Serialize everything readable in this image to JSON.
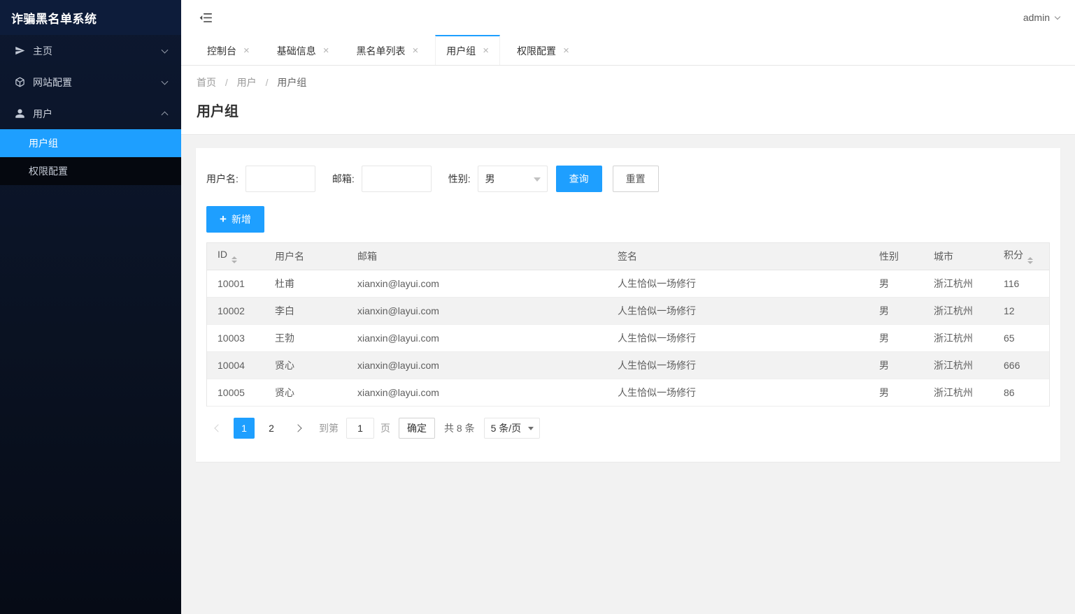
{
  "app": {
    "title": "诈骗黑名单系统"
  },
  "header": {
    "user": "admin"
  },
  "icons": {
    "close": "×",
    "plus": "+"
  },
  "colors": {
    "accent": "#1e9fff",
    "sidebar_bg": "#0b1326",
    "stripe": "#f2f2f2"
  },
  "sidebar": {
    "menu": [
      {
        "label": "主页"
      },
      {
        "label": "网站配置"
      },
      {
        "label": "用户"
      }
    ],
    "submenu": [
      {
        "label": "用户组",
        "active": true
      },
      {
        "label": "权限配置",
        "active": false
      }
    ]
  },
  "tabs": [
    {
      "label": "控制台",
      "active": false
    },
    {
      "label": "基础信息",
      "active": false
    },
    {
      "label": "黑名单列表",
      "active": false
    },
    {
      "label": "用户组",
      "active": true
    },
    {
      "label": "权限配置",
      "active": false
    }
  ],
  "breadcrumb": {
    "items": [
      "首页",
      "用户",
      "用户组"
    ],
    "separator": "/"
  },
  "page": {
    "title": "用户组"
  },
  "search": {
    "username_label": "用户名:",
    "email_label": "邮箱:",
    "gender_label": "性别:",
    "gender_value": "男",
    "query_button": "查询",
    "reset_button": "重置"
  },
  "toolbar": {
    "add_button": "新增"
  },
  "table": {
    "columns": [
      {
        "label": "ID",
        "sortable": true
      },
      {
        "label": "用户名",
        "sortable": false
      },
      {
        "label": "邮箱",
        "sortable": false
      },
      {
        "label": "签名",
        "sortable": false
      },
      {
        "label": "性别",
        "sortable": false
      },
      {
        "label": "城市",
        "sortable": false
      },
      {
        "label": "积分",
        "sortable": true
      }
    ],
    "rows": [
      [
        "10001",
        "杜甫",
        "xianxin@layui.com",
        "人生恰似一场修行",
        "男",
        "浙江杭州",
        "116"
      ],
      [
        "10002",
        "李白",
        "xianxin@layui.com",
        "人生恰似一场修行",
        "男",
        "浙江杭州",
        "12"
      ],
      [
        "10003",
        "王勃",
        "xianxin@layui.com",
        "人生恰似一场修行",
        "男",
        "浙江杭州",
        "65"
      ],
      [
        "10004",
        "贤心",
        "xianxin@layui.com",
        "人生恰似一场修行",
        "男",
        "浙江杭州",
        "666"
      ],
      [
        "10005",
        "贤心",
        "xianxin@layui.com",
        "人生恰似一场修行",
        "男",
        "浙江杭州",
        "86"
      ]
    ]
  },
  "pagination": {
    "pages": [
      {
        "label": "1",
        "active": true
      },
      {
        "label": "2",
        "active": false
      }
    ],
    "goto_label": "到第",
    "goto_value": "1",
    "goto_unit": "页",
    "confirm_label": "确定",
    "total_label": "共 8 条",
    "page_size": "5 条/页"
  }
}
